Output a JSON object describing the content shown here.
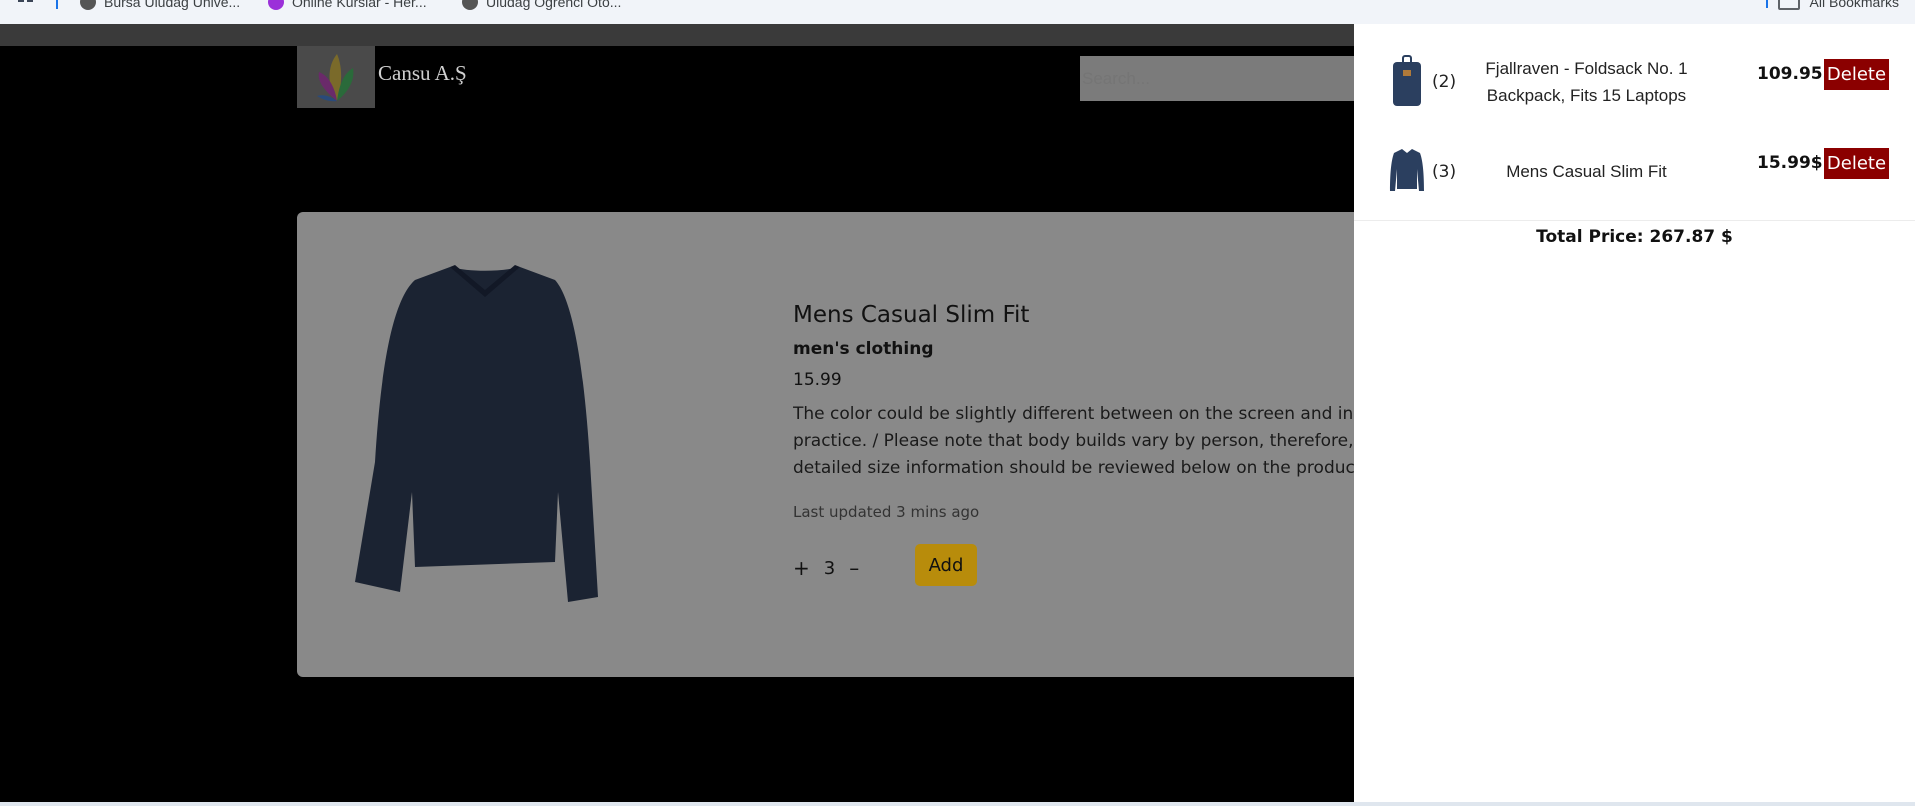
{
  "bookmarks": {
    "items": [
      {
        "label": "Bursa Uludağ Ünive..."
      },
      {
        "label": "Online Kurslar - Her..."
      },
      {
        "label": "Uludağ Öğrenci Oto..."
      }
    ],
    "all_bookmarks": "All Bookmarks"
  },
  "header": {
    "brand": "Cansu A.Ş",
    "search_placeholder": "Search..."
  },
  "product": {
    "title": "Mens Casual Slim Fit",
    "category": "men's clothing",
    "price": "15.99",
    "description": "The color could be slightly different between on the screen and in practice. / Please note that body builds vary by person, therefore, detailed size information should be reviewed below on the product description.",
    "updated": "Last updated 3 mins ago",
    "quantity": "3",
    "plus": "+",
    "minus": "–",
    "add_label": "Add"
  },
  "cart": {
    "items": [
      {
        "count": "(2)",
        "name": "Fjallraven - Foldsack No. 1 Backpack, Fits 15 Laptops",
        "price": "109.95$",
        "delete_label": "Delete",
        "icon": "backpack-icon"
      },
      {
        "count": "(3)",
        "name": "Mens Casual Slim Fit",
        "price": "15.99$",
        "delete_label": "Delete",
        "icon": "shirt-icon"
      }
    ],
    "total": "Total Price: 267.87 $"
  },
  "colors": {
    "add_button": "#b88c0b",
    "delete_button": "#8b0000",
    "overlay": "#000000"
  }
}
